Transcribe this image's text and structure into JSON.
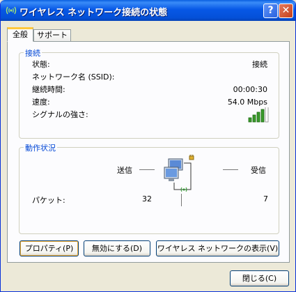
{
  "window": {
    "title": "ワイヤレス ネットワーク接続の状態",
    "help_label": "?",
    "close_label": "✕"
  },
  "tabs": [
    {
      "label": "全般"
    },
    {
      "label": "サポート"
    }
  ],
  "connection": {
    "group_title": "接続",
    "rows": [
      {
        "label": "状態:",
        "value": "接続"
      },
      {
        "label": "ネットワーク名 (SSID):",
        "value": ""
      },
      {
        "label": "継続時間:",
        "value": "00:00:30"
      },
      {
        "label": "速度:",
        "value": "54.0 Mbps"
      },
      {
        "label": "シグナルの強さ:",
        "value": ""
      }
    ],
    "signal_bars_lit": 4,
    "signal_bars_total": 5
  },
  "activity": {
    "group_title": "動作状況",
    "sent_label": "送信",
    "received_label": "受信",
    "packets_label": "パケット:",
    "packets_sent": "32",
    "packets_received": "7"
  },
  "buttons": {
    "properties": "プロパティ(P)",
    "disable": "無効にする(D)",
    "view_networks": "ワイヤレス ネットワークの表示(V)",
    "close": "閉じる(C)"
  },
  "colors": {
    "accent": "#0046d5",
    "title_bar": "#0758e6",
    "signal": "#3a9a2a"
  }
}
